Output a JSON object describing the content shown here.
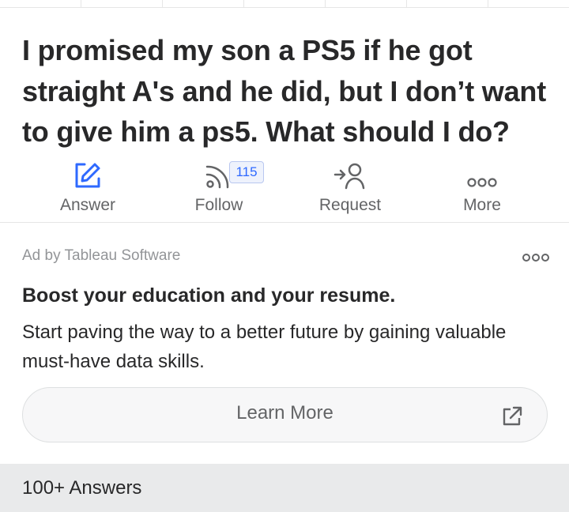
{
  "question": {
    "title": "I promised my son a PS5 if he got straight A's and he did, but I don’t want to give him a ps5. What should I do?"
  },
  "actions": [
    {
      "label": "Answer",
      "icon": "pencil-edit-icon"
    },
    {
      "label": "Follow",
      "icon": "rss-follow-icon",
      "count": "115"
    },
    {
      "label": "Request",
      "icon": "request-person-icon"
    },
    {
      "label": "More",
      "icon": "more-dots-icon"
    }
  ],
  "ad": {
    "sponsor_label": "Ad by Tableau Software",
    "headline": "Boost your education and your resume.",
    "body": "Start paving the way to a better future by gaining valuable must-have data skills.",
    "cta_label": "Learn More"
  },
  "answers_bar": {
    "label": "100+ Answers"
  },
  "colors": {
    "accent": "#2e69ff",
    "text_primary": "#282829",
    "text_secondary": "#636466",
    "muted": "#939598",
    "divider": "#e6e6e6",
    "answers_bar_bg": "#e9eaeb"
  }
}
